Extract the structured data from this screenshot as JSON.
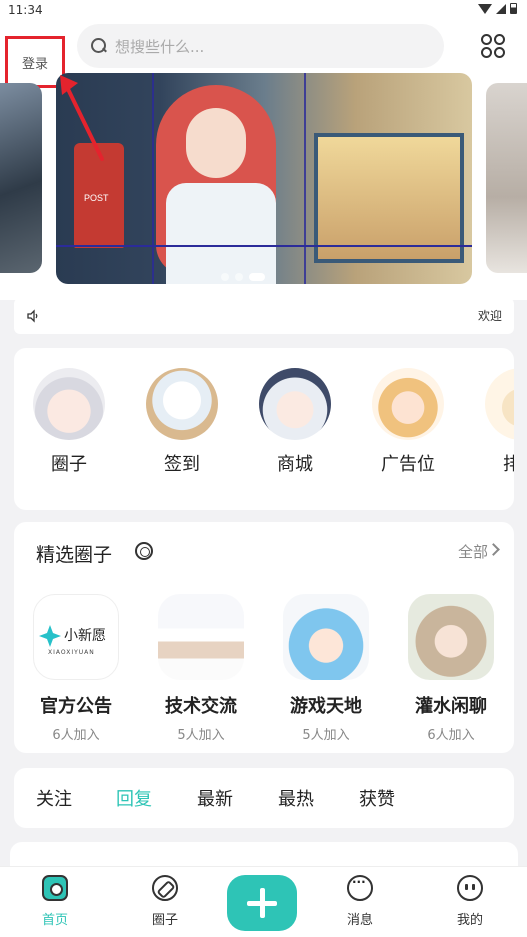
{
  "status_bar": {
    "time": "11:34"
  },
  "header": {
    "login_label": "登录",
    "search_placeholder": "想搜些什么..."
  },
  "banner": {
    "post_label": "POST"
  },
  "notice": {
    "text": "欢迎"
  },
  "menu": {
    "items": [
      {
        "label": "圈子",
        "icon": "avatar-silver-hair-girl"
      },
      {
        "label": "签到",
        "icon": "avatar-white-hair-in-box"
      },
      {
        "label": "商城",
        "icon": "avatar-white-hair-hat"
      },
      {
        "label": "广告位",
        "icon": "avatar-fox-girl"
      },
      {
        "label": "排行",
        "icon": "avatar-fox-partial"
      }
    ]
  },
  "featured": {
    "title": "精选圈子",
    "all_label": "全部",
    "circles": [
      {
        "name": "官方公告",
        "count": "6人加入",
        "logo_text": "小新愿",
        "logo_sub": "XIAOXIYUAN"
      },
      {
        "name": "技术交流",
        "count": "5人加入"
      },
      {
        "name": "游戏天地",
        "count": "5人加入"
      },
      {
        "name": "灌水闲聊",
        "count": "6人加入"
      }
    ]
  },
  "tabs": {
    "items": [
      "关注",
      "回复",
      "最新",
      "最热",
      "获赞"
    ],
    "active": "回复"
  },
  "bottom_nav": {
    "items": [
      {
        "label": "首页",
        "icon": "home-icon"
      },
      {
        "label": "圈子",
        "icon": "compass-icon"
      },
      {
        "label": "消息",
        "icon": "chat-icon"
      },
      {
        "label": "我的",
        "icon": "face-icon"
      }
    ],
    "active": "首页"
  },
  "colors": {
    "accent": "#2ec4b6",
    "highlight_box": "#e4232d"
  }
}
